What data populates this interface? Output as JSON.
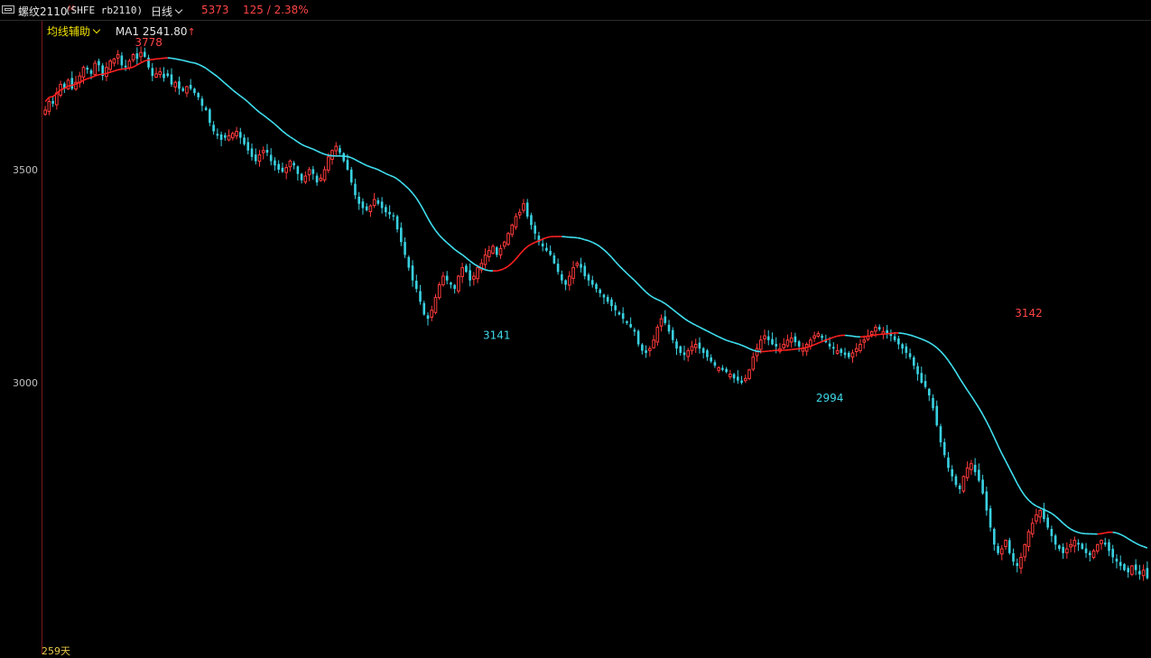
{
  "header": {
    "symbol": "螺纹2110",
    "symbol_sup": "M",
    "code": "(SHFE rb2110)",
    "period": "日线",
    "volume": "5373",
    "change": "125 / 2.38%"
  },
  "indicator": {
    "name": "均线辅助",
    "ma_label": "MA1 2541.80",
    "arrow": "↑"
  },
  "axis": {
    "y_labels": [
      "3500",
      "3000"
    ],
    "days_label": "259天"
  },
  "colors": {
    "up": "#ff3b3b",
    "down": "#39d0e0",
    "ma_up": "#ff2020",
    "ma_down": "#40e0f0"
  },
  "icons": [
    "window-icon",
    "chevron-down-icon"
  ],
  "chart_data": {
    "type": "candlestick",
    "ylim": [
      2480,
      3860
    ],
    "y_ticks": [
      3500,
      3000
    ],
    "annotations": [
      {
        "label": "3778",
        "bar": 27,
        "price": 3778,
        "color": "red"
      },
      {
        "label": "3141",
        "bar": 118,
        "price": 3141,
        "color": "cyan"
      },
      {
        "label": "2994",
        "bar": 205,
        "price": 2994,
        "color": "cyan"
      },
      {
        "label": "3142",
        "bar": 257,
        "price": 3142,
        "color": "red"
      }
    ],
    "close": [
      3640,
      3660,
      3655,
      3680,
      3700,
      3690,
      3710,
      3690,
      3705,
      3720,
      3740,
      3735,
      3725,
      3750,
      3745,
      3720,
      3740,
      3755,
      3760,
      3770,
      3745,
      3740,
      3755,
      3770,
      3760,
      3775,
      3765,
      3740,
      3720,
      3725,
      3730,
      3715,
      3720,
      3700,
      3705,
      3690,
      3685,
      3695,
      3690,
      3680,
      3670,
      3650,
      3640,
      3610,
      3590,
      3580,
      3570,
      3575,
      3580,
      3585,
      3590,
      3575,
      3560,
      3545,
      3530,
      3520,
      3535,
      3545,
      3540,
      3520,
      3510,
      3500,
      3495,
      3505,
      3520,
      3510,
      3490,
      3475,
      3485,
      3500,
      3490,
      3470,
      3480,
      3500,
      3530,
      3545,
      3555,
      3540,
      3520,
      3500,
      3470,
      3440,
      3420,
      3410,
      3405,
      3415,
      3430,
      3420,
      3410,
      3400,
      3395,
      3390,
      3360,
      3330,
      3300,
      3270,
      3240,
      3220,
      3190,
      3160,
      3150,
      3170,
      3200,
      3230,
      3250,
      3240,
      3230,
      3220,
      3250,
      3270,
      3260,
      3240,
      3250,
      3270,
      3280,
      3300,
      3310,
      3320,
      3300,
      3315,
      3330,
      3350,
      3370,
      3390,
      3400,
      3420,
      3390,
      3370,
      3350,
      3330,
      3320,
      3310,
      3300,
      3280,
      3260,
      3240,
      3230,
      3250,
      3270,
      3280,
      3270,
      3250,
      3240,
      3230,
      3220,
      3210,
      3200,
      3190,
      3180,
      3170,
      3160,
      3150,
      3140,
      3130,
      3120,
      3090,
      3075,
      3070,
      3080,
      3100,
      3130,
      3150,
      3140,
      3120,
      3100,
      3080,
      3070,
      3065,
      3075,
      3085,
      3090,
      3080,
      3070,
      3060,
      3050,
      3040,
      3035,
      3030,
      3025,
      3020,
      3010,
      3005,
      3000,
      3010,
      3030,
      3060,
      3080,
      3100,
      3110,
      3100,
      3090,
      3085,
      3080,
      3090,
      3100,
      3105,
      3095,
      3085,
      3080,
      3090,
      3100,
      3110,
      3115,
      3105,
      3095,
      3085,
      3080,
      3075,
      3070,
      3065,
      3060,
      3070,
      3080,
      3090,
      3100,
      3110,
      3120,
      3130,
      3125,
      3120,
      3115,
      3110,
      3100,
      3090,
      3080,
      3070,
      3060,
      3040,
      3020,
      3000,
      2990,
      2970,
      2940,
      2900,
      2860,
      2830,
      2800,
      2780,
      2760,
      2750,
      2780,
      2800,
      2810,
      2790,
      2770,
      2740,
      2700,
      2660,
      2620,
      2600,
      2610,
      2630,
      2600,
      2580,
      2570,
      2590,
      2620,
      2650,
      2670,
      2690,
      2700,
      2680,
      2660,
      2640,
      2620,
      2610,
      2600,
      2610,
      2620,
      2630,
      2620,
      2610,
      2600,
      2595,
      2605,
      2620,
      2630,
      2620,
      2605,
      2590,
      2580,
      2570,
      2560,
      2555,
      2570,
      2560,
      2550,
      2560,
      2541
    ]
  }
}
